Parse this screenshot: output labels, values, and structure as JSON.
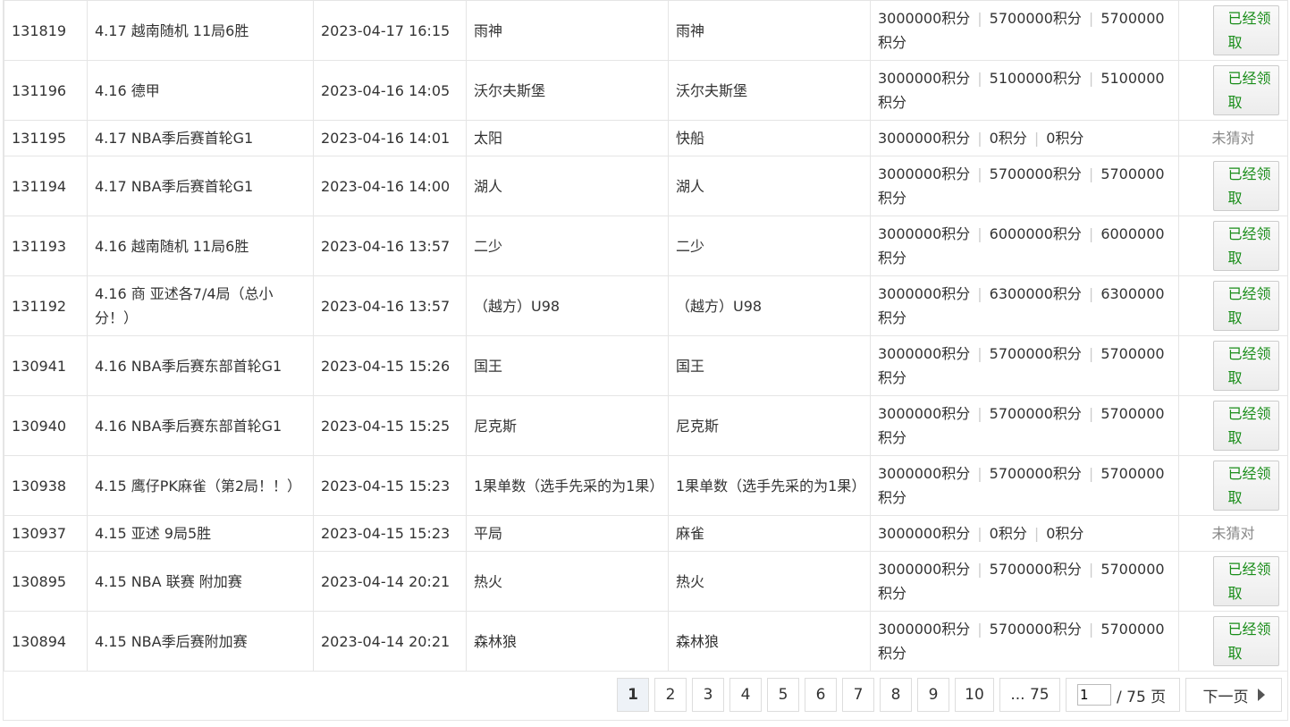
{
  "rows": [
    {
      "id": "131819",
      "title": "4.17 越南随机 11局6胜",
      "time": "2023-04-17 16:15",
      "pick": "雨神",
      "result": "雨神",
      "stake": "3000000积分",
      "win": "5700000积分",
      "gain": "5700000积分",
      "status": "已经领取",
      "claimed": true
    },
    {
      "id": "131196",
      "title": "4.16 德甲",
      "time": "2023-04-16 14:05",
      "pick": "沃尔夫斯堡",
      "result": "沃尔夫斯堡",
      "stake": "3000000积分",
      "win": "5100000积分",
      "gain": "5100000积分",
      "status": "已经领取",
      "claimed": true
    },
    {
      "id": "131195",
      "title": "4.17 NBA季后赛首轮G1",
      "time": "2023-04-16 14:01",
      "pick": "太阳",
      "result": "快船",
      "stake": "3000000积分",
      "win": "0积分",
      "gain": "0积分",
      "status": "未猜对",
      "claimed": false
    },
    {
      "id": "131194",
      "title": "4.17 NBA季后赛首轮G1",
      "time": "2023-04-16 14:00",
      "pick": "湖人",
      "result": "湖人",
      "stake": "3000000积分",
      "win": "5700000积分",
      "gain": "5700000积分",
      "status": "已经领取",
      "claimed": true
    },
    {
      "id": "131193",
      "title": "4.16 越南随机 11局6胜",
      "time": "2023-04-16 13:57",
      "pick": "二少",
      "result": "二少",
      "stake": "3000000积分",
      "win": "6000000积分",
      "gain": "6000000积分",
      "status": "已经领取",
      "claimed": true
    },
    {
      "id": "131192",
      "title": "4.16 商 亚述各7/4局（总小分！）",
      "time": "2023-04-16 13:57",
      "pick": "（越方）U98",
      "result": "（越方）U98",
      "stake": "3000000积分",
      "win": "6300000积分",
      "gain": "6300000积分",
      "status": "已经领取",
      "claimed": true
    },
    {
      "id": "130941",
      "title": "4.16 NBA季后赛东部首轮G1",
      "time": "2023-04-15 15:26",
      "pick": "国王",
      "result": "国王",
      "stake": "3000000积分",
      "win": "5700000积分",
      "gain": "5700000积分",
      "status": "已经领取",
      "claimed": true
    },
    {
      "id": "130940",
      "title": "4.16 NBA季后赛东部首轮G1",
      "time": "2023-04-15 15:25",
      "pick": "尼克斯",
      "result": "尼克斯",
      "stake": "3000000积分",
      "win": "5700000积分",
      "gain": "5700000积分",
      "status": "已经领取",
      "claimed": true
    },
    {
      "id": "130938",
      "title": "4.15 鹰仔PK麻雀（第2局！！）",
      "time": "2023-04-15 15:23",
      "pick": "1果单数（选手先采的为1果）",
      "result": "1果单数（选手先采的为1果）",
      "stake": "3000000积分",
      "win": "5700000积分",
      "gain": "5700000积分",
      "status": "已经领取",
      "claimed": true
    },
    {
      "id": "130937",
      "title": "4.15 亚述 9局5胜",
      "time": "2023-04-15 15:23",
      "pick": "平局",
      "result": "麻雀",
      "stake": "3000000积分",
      "win": "0积分",
      "gain": "0积分",
      "status": "未猜对",
      "claimed": false
    },
    {
      "id": "130895",
      "title": "4.15 NBA 联赛 附加赛",
      "time": "2023-04-14 20:21",
      "pick": "热火",
      "result": "热火",
      "stake": "3000000积分",
      "win": "5700000积分",
      "gain": "5700000积分",
      "status": "已经领取",
      "claimed": true
    },
    {
      "id": "130894",
      "title": "4.15 NBA季后赛附加赛",
      "time": "2023-04-14 20:21",
      "pick": "森林狼",
      "result": "森林狼",
      "stake": "3000000积分",
      "win": "5700000积分",
      "gain": "5700000积分",
      "status": "已经领取",
      "claimed": true
    }
  ],
  "pagination": {
    "pages": [
      "1",
      "2",
      "3",
      "4",
      "5",
      "6",
      "7",
      "8",
      "9",
      "10"
    ],
    "active": "1",
    "last": "... 75",
    "jump_value": "1",
    "total_label": "/ 75 页",
    "next_label": "下一页"
  }
}
